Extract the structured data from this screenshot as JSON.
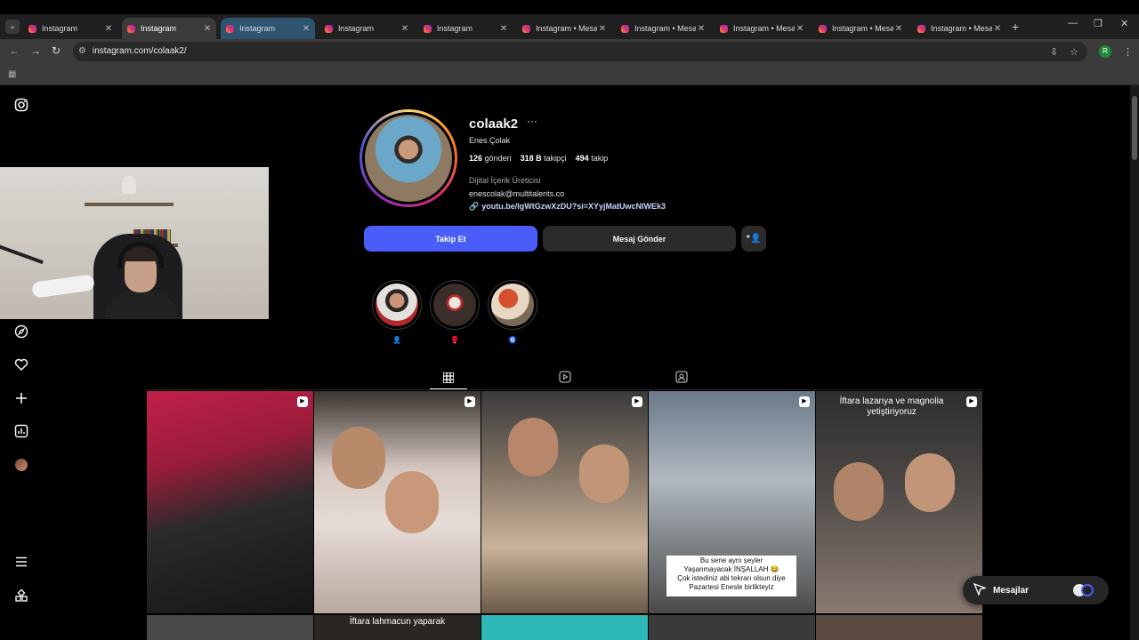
{
  "browser": {
    "tabs": [
      {
        "title": "Instagram"
      },
      {
        "title": "Instagram"
      },
      {
        "title": "Instagram"
      },
      {
        "title": "Instagram"
      },
      {
        "title": "Instagram"
      },
      {
        "title": "Instagram • Mesa"
      },
      {
        "title": "Instagram • Mesa"
      },
      {
        "title": "Instagram • Mesa"
      },
      {
        "title": "Instagram • Mesa"
      },
      {
        "title": "Instagram • Mesa"
      }
    ],
    "active_tab_index": 1,
    "url": "instagram.com/colaak2/",
    "profile_initial": "R"
  },
  "profile": {
    "username": "colaak2",
    "full_name": "Enes Çolak",
    "posts_count": "126",
    "posts_label": "gönderi",
    "followers_count": "318 B",
    "followers_label": "takipçi",
    "following_count": "494",
    "following_label": "takip",
    "category": "Dijital İçerik Üreticisi",
    "email": "enescolak@multitalents.co",
    "link": "youtu.be/IgWtGzwXzDU?si=XYyjMatUwcNIWEk3",
    "follow_button": "Takip Et",
    "message_button": "Mesaj Gönder"
  },
  "highlights": [
    {
      "label": "👤"
    },
    {
      "label": "🥊"
    },
    {
      "label": "🧿"
    }
  ],
  "posts": [
    {
      "caption": ""
    },
    {
      "caption": ""
    },
    {
      "caption": ""
    },
    {
      "caption": "Bu sene aynı şeyler\nYaşanmayacak İNŞALLAH 😂\nÇok istediniz abi tekrarı olsun diye\nPazartesi Enesle birlikteyiz"
    },
    {
      "caption": "İftara lazanya ve magnolia\nyetiştiriyoruz"
    }
  ],
  "row2_captions": [
    "",
    "İftara lahmacun yaparak",
    "",
    "",
    ""
  ],
  "messages": {
    "label": "Mesajlar"
  }
}
